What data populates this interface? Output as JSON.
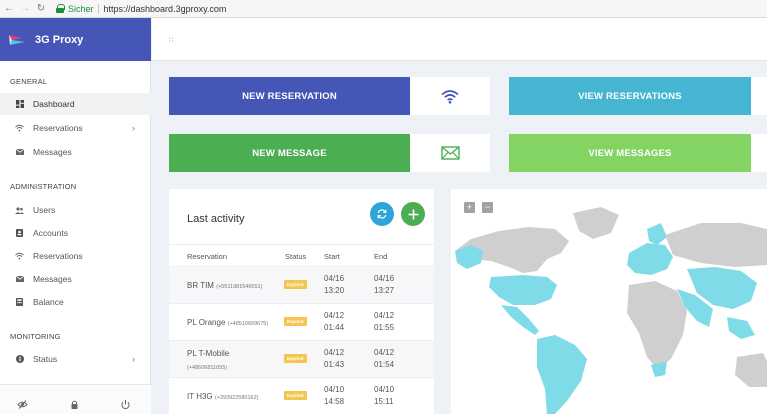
{
  "browser": {
    "secure_label": "Sicher",
    "url": "https://dashboard.3gproxy.com"
  },
  "brand": {
    "name": "3G Proxy"
  },
  "sidebar": {
    "sections": [
      {
        "title": "GENERAL"
      },
      {
        "title": "ADMINISTRATION"
      },
      {
        "title": "MONITORING"
      }
    ],
    "items": [
      {
        "label": "Dashboard",
        "icon": "dashboard-icon",
        "active": true
      },
      {
        "label": "Reservations",
        "icon": "wifi-icon"
      },
      {
        "label": "Messages",
        "icon": "envelope-icon"
      },
      {
        "label": "Users",
        "icon": "users-icon"
      },
      {
        "label": "Accounts",
        "icon": "account-icon"
      },
      {
        "label": "Reservations",
        "icon": "wifi-icon"
      },
      {
        "label": "Messages",
        "icon": "envelope-icon"
      },
      {
        "label": "Balance",
        "icon": "balance-icon"
      },
      {
        "label": "Status",
        "icon": "info-icon"
      }
    ],
    "footer_icons": [
      "eye-slash-icon",
      "lock-icon",
      "power-icon"
    ]
  },
  "header": {
    "menu_icon": "grid-dots-icon"
  },
  "actions": {
    "new_reservation": "NEW RESERVATION",
    "view_reservations": "VIEW RESERVATIONS",
    "new_message": "NEW MESSAGE",
    "view_messages": "VIEW MESSAGES"
  },
  "colors": {
    "indigo": "#4556b6",
    "cyan": "#45b5d2",
    "green": "#4cae52",
    "light_green": "#84d463",
    "badge": "#f5c64f",
    "map_land": "#cfcfcf",
    "map_highlight": "#7fdbe8"
  },
  "activity": {
    "title": "Last activity",
    "columns": [
      "Reservation",
      "Status",
      "Start",
      "End"
    ],
    "rows": [
      {
        "name": "BR TIM",
        "phone": "(+5511981546551)",
        "status": "Expired",
        "start_date": "04/16",
        "start_time": "13:20",
        "end_date": "04/16",
        "end_time": "13:27"
      },
      {
        "name": "PL Orange",
        "phone": "(+48510609675)",
        "status": "Expired",
        "start_date": "04/12",
        "start_time": "01:44",
        "end_date": "04/12",
        "end_time": "01:55"
      },
      {
        "name": "PL T-Mobile",
        "phone": "(+48606811055)",
        "status": "Expired",
        "start_date": "04/12",
        "start_time": "01:43",
        "end_date": "04/12",
        "end_time": "01:54"
      },
      {
        "name": "IT H3G",
        "phone": "(+393922580162)",
        "status": "Expired",
        "start_date": "04/10",
        "start_time": "14:58",
        "end_date": "04/10",
        "end_time": "15:11"
      }
    ]
  },
  "map": {
    "zoom_in": "+",
    "zoom_out": "−"
  }
}
